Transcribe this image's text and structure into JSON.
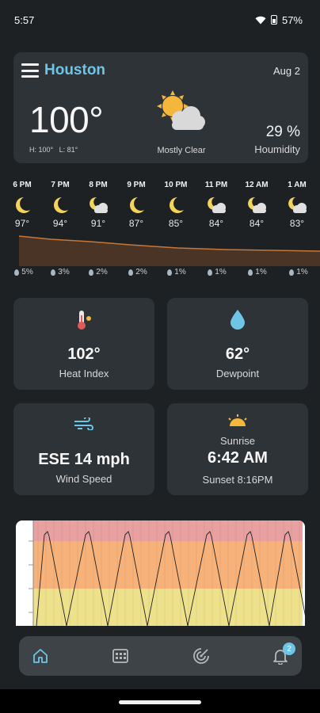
{
  "status_bar": {
    "time": "5:57",
    "battery": "57%"
  },
  "header": {
    "city": "Houston",
    "date": "Aug 2"
  },
  "current": {
    "temperature": "100°",
    "hi": "H: 100°",
    "lo": "L: 81°",
    "condition": "Mostly Clear",
    "humidity_value": "29 %",
    "humidity_label": "Houmidity"
  },
  "hourly": [
    {
      "time": "6 PM",
      "icon": "moon-icon",
      "temp": "97°",
      "precip": "5%"
    },
    {
      "time": "7 PM",
      "icon": "moon-icon",
      "temp": "94°",
      "precip": "3%"
    },
    {
      "time": "8 PM",
      "icon": "moon-cloud-icon",
      "temp": "91°",
      "precip": "2%"
    },
    {
      "time": "9 PM",
      "icon": "moon-icon",
      "temp": "87°",
      "precip": "2%"
    },
    {
      "time": "10 PM",
      "icon": "moon-icon",
      "temp": "85°",
      "precip": "1%"
    },
    {
      "time": "11 PM",
      "icon": "moon-cloud-icon",
      "temp": "84°",
      "precip": "1%"
    },
    {
      "time": "12 AM",
      "icon": "moon-cloud-icon",
      "temp": "84°",
      "precip": "1%"
    },
    {
      "time": "1 AM",
      "icon": "moon-cloud-icon",
      "temp": "83°",
      "precip": "1%"
    }
  ],
  "tiles": {
    "heat_index": {
      "value": "102°",
      "label": "Heat Index"
    },
    "dewpoint": {
      "value": "62°",
      "label": "Dewpoint"
    },
    "wind": {
      "value": "ESE 14 mph",
      "label": "Wind Speed"
    },
    "sun": {
      "label": "Sunrise",
      "sunrise": "6:42 AM",
      "sunset": "Sunset  8:16PM"
    }
  },
  "nav": {
    "items": [
      {
        "icon": "home-icon",
        "active": true
      },
      {
        "icon": "calendar-icon",
        "active": false
      },
      {
        "icon": "radar-icon",
        "active": false
      },
      {
        "icon": "bell-icon",
        "active": false
      }
    ],
    "badge_count": "2"
  },
  "colors": {
    "accent": "#6ec5e6",
    "card": "#2e3337",
    "background": "#1d2124",
    "moon": "#f2d35c",
    "sun": "#f4b73c"
  },
  "chart_data": {
    "type": "line",
    "bands": [
      {
        "color": "#e8a0a0"
      },
      {
        "color": "#f7b27a"
      },
      {
        "color": "#ede18c"
      }
    ],
    "y_tick_labels": [
      "",
      "",
      "",
      "",
      ""
    ]
  }
}
